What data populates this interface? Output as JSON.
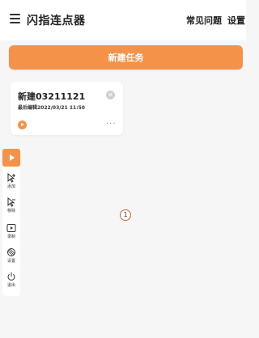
{
  "header": {
    "title": "闪指连点器",
    "faq_label": "常见问题",
    "settings_label": "设置"
  },
  "main": {
    "new_task_label": "新建任务"
  },
  "task": {
    "name": "新建03211121",
    "time": "最后编辑2022/03/21 11:50",
    "close_icon": "close-icon",
    "play_icon": "play-icon",
    "more_label": "···"
  },
  "toolbar": {
    "items": [
      {
        "icon": "play-icon",
        "label": ""
      },
      {
        "icon": "add-click-icon",
        "label": "添加"
      },
      {
        "icon": "remove-click-icon",
        "label": "移除"
      },
      {
        "icon": "record-icon",
        "label": "录制"
      },
      {
        "icon": "settings-icon",
        "label": "设置"
      },
      {
        "icon": "power-icon",
        "label": "退出"
      }
    ]
  },
  "target": {
    "number": "1"
  },
  "colors": {
    "accent": "#f5924a",
    "background": "#f6f6f6"
  }
}
